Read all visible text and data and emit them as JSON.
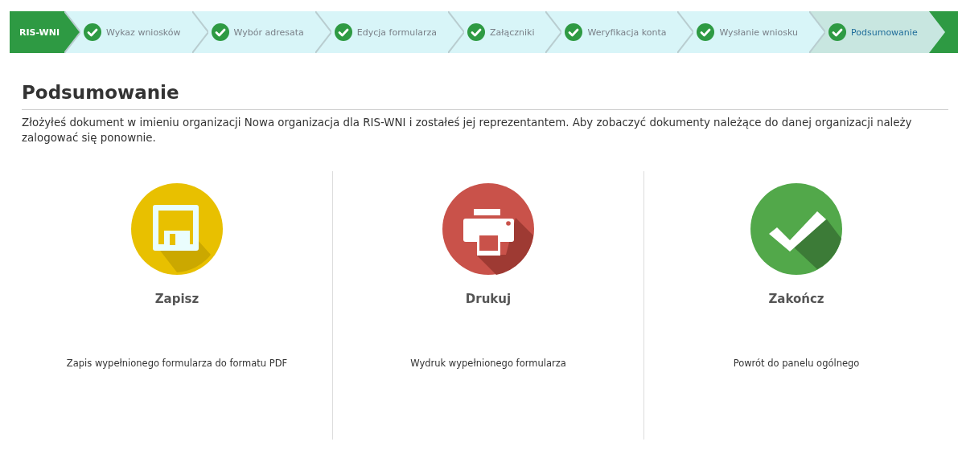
{
  "breadcrumb": {
    "brand": "RIS-WNI",
    "steps": [
      {
        "label": "Wykaz wniosków",
        "done": true,
        "selected": false
      },
      {
        "label": "Wybór adresata",
        "done": true,
        "selected": false
      },
      {
        "label": "Edycja formularza",
        "done": true,
        "selected": false
      },
      {
        "label": "Załączniki",
        "done": true,
        "selected": false
      },
      {
        "label": "Weryfikacja konta",
        "done": true,
        "selected": false
      },
      {
        "label": "Wysłanie wniosku",
        "done": true,
        "selected": false
      },
      {
        "label": "Podsumowanie",
        "done": true,
        "selected": true
      }
    ]
  },
  "page": {
    "title": "Podsumowanie",
    "message": "Złożyłeś dokument w imieniu organizacji Nowa organizacja dla RIS-WNI i zostałeś jej reprezentantem. Aby zobaczyć dokumenty należące do danej organizacji należy zalogować się ponownie."
  },
  "actions": [
    {
      "kind": "save",
      "label": "Zapisz",
      "description": "Zapis wypełnionego formularza do formatu PDF"
    },
    {
      "kind": "print",
      "label": "Drukuj",
      "description": "Wydruk wypełnionego formularza"
    },
    {
      "kind": "finish",
      "label": "Zakończ",
      "description": "Powrót do panelu ogólnego"
    }
  ]
}
